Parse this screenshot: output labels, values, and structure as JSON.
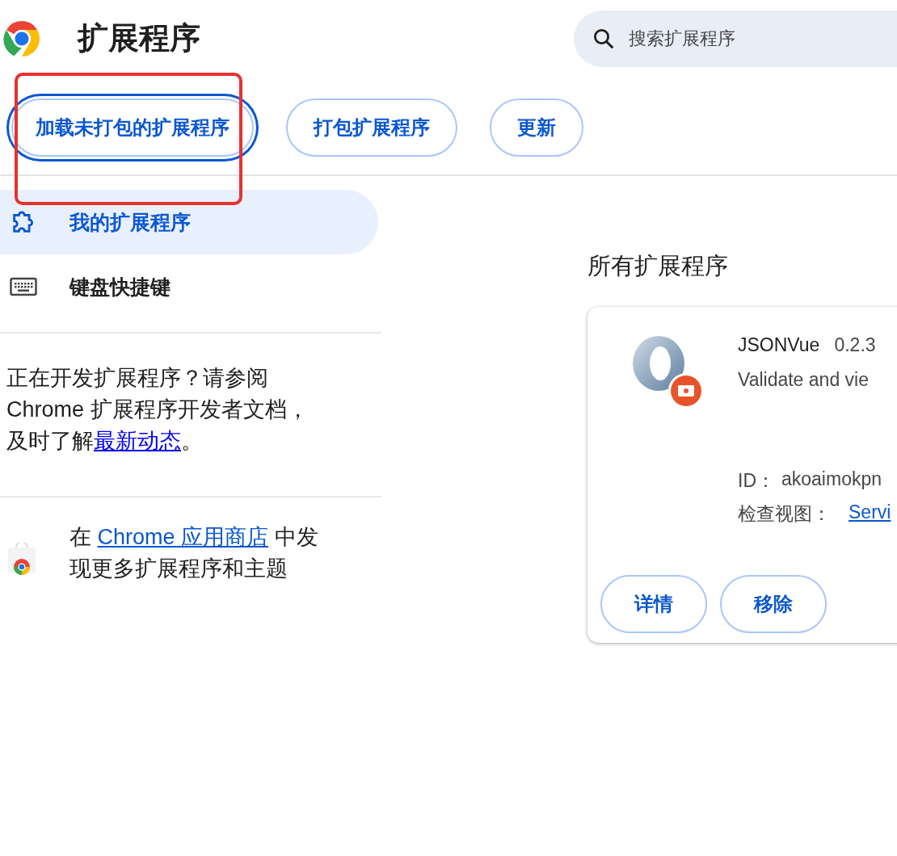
{
  "header": {
    "title": "扩展程序",
    "search": {
      "placeholder": "搜索扩展程序"
    }
  },
  "toolbar": [
    {
      "label": "加载未打包的扩展程序",
      "focused": true
    },
    {
      "label": "打包扩展程序",
      "focused": false
    },
    {
      "label": "更新",
      "focused": false
    }
  ],
  "sidebar": {
    "items": [
      {
        "label": "我的扩展程序",
        "selected": true
      },
      {
        "label": "键盘快捷键",
        "selected": false
      }
    ],
    "dev_note": [
      [
        {
          "text": "正在开发扩展程序？请参阅",
          "link": false
        }
      ],
      [
        {
          "text": "Chrome 扩展程序开发者文档，",
          "link": false
        }
      ],
      [
        {
          "text": "及时了解",
          "link": false
        },
        {
          "text": "最新动态",
          "link": true
        },
        {
          "text": "。",
          "link": false
        }
      ]
    ],
    "store_note": [
      [
        {
          "text": "在 ",
          "link": false
        },
        {
          "text": "Chrome 应用商店",
          "link": true
        },
        {
          "text": " 中发",
          "link": false
        }
      ],
      [
        {
          "text": "现更多扩展程序和主题",
          "link": false
        }
      ]
    ]
  },
  "main": {
    "heading": "所有扩展程序",
    "card": {
      "name": "JSONVue",
      "version": "0.2.3",
      "description": "Validate and vie",
      "id_label": "ID：",
      "id_value": "akoaimokpn",
      "views_label": "检查视图：",
      "views_link": "Servi",
      "buttons": [
        "详情",
        "移除"
      ]
    }
  }
}
